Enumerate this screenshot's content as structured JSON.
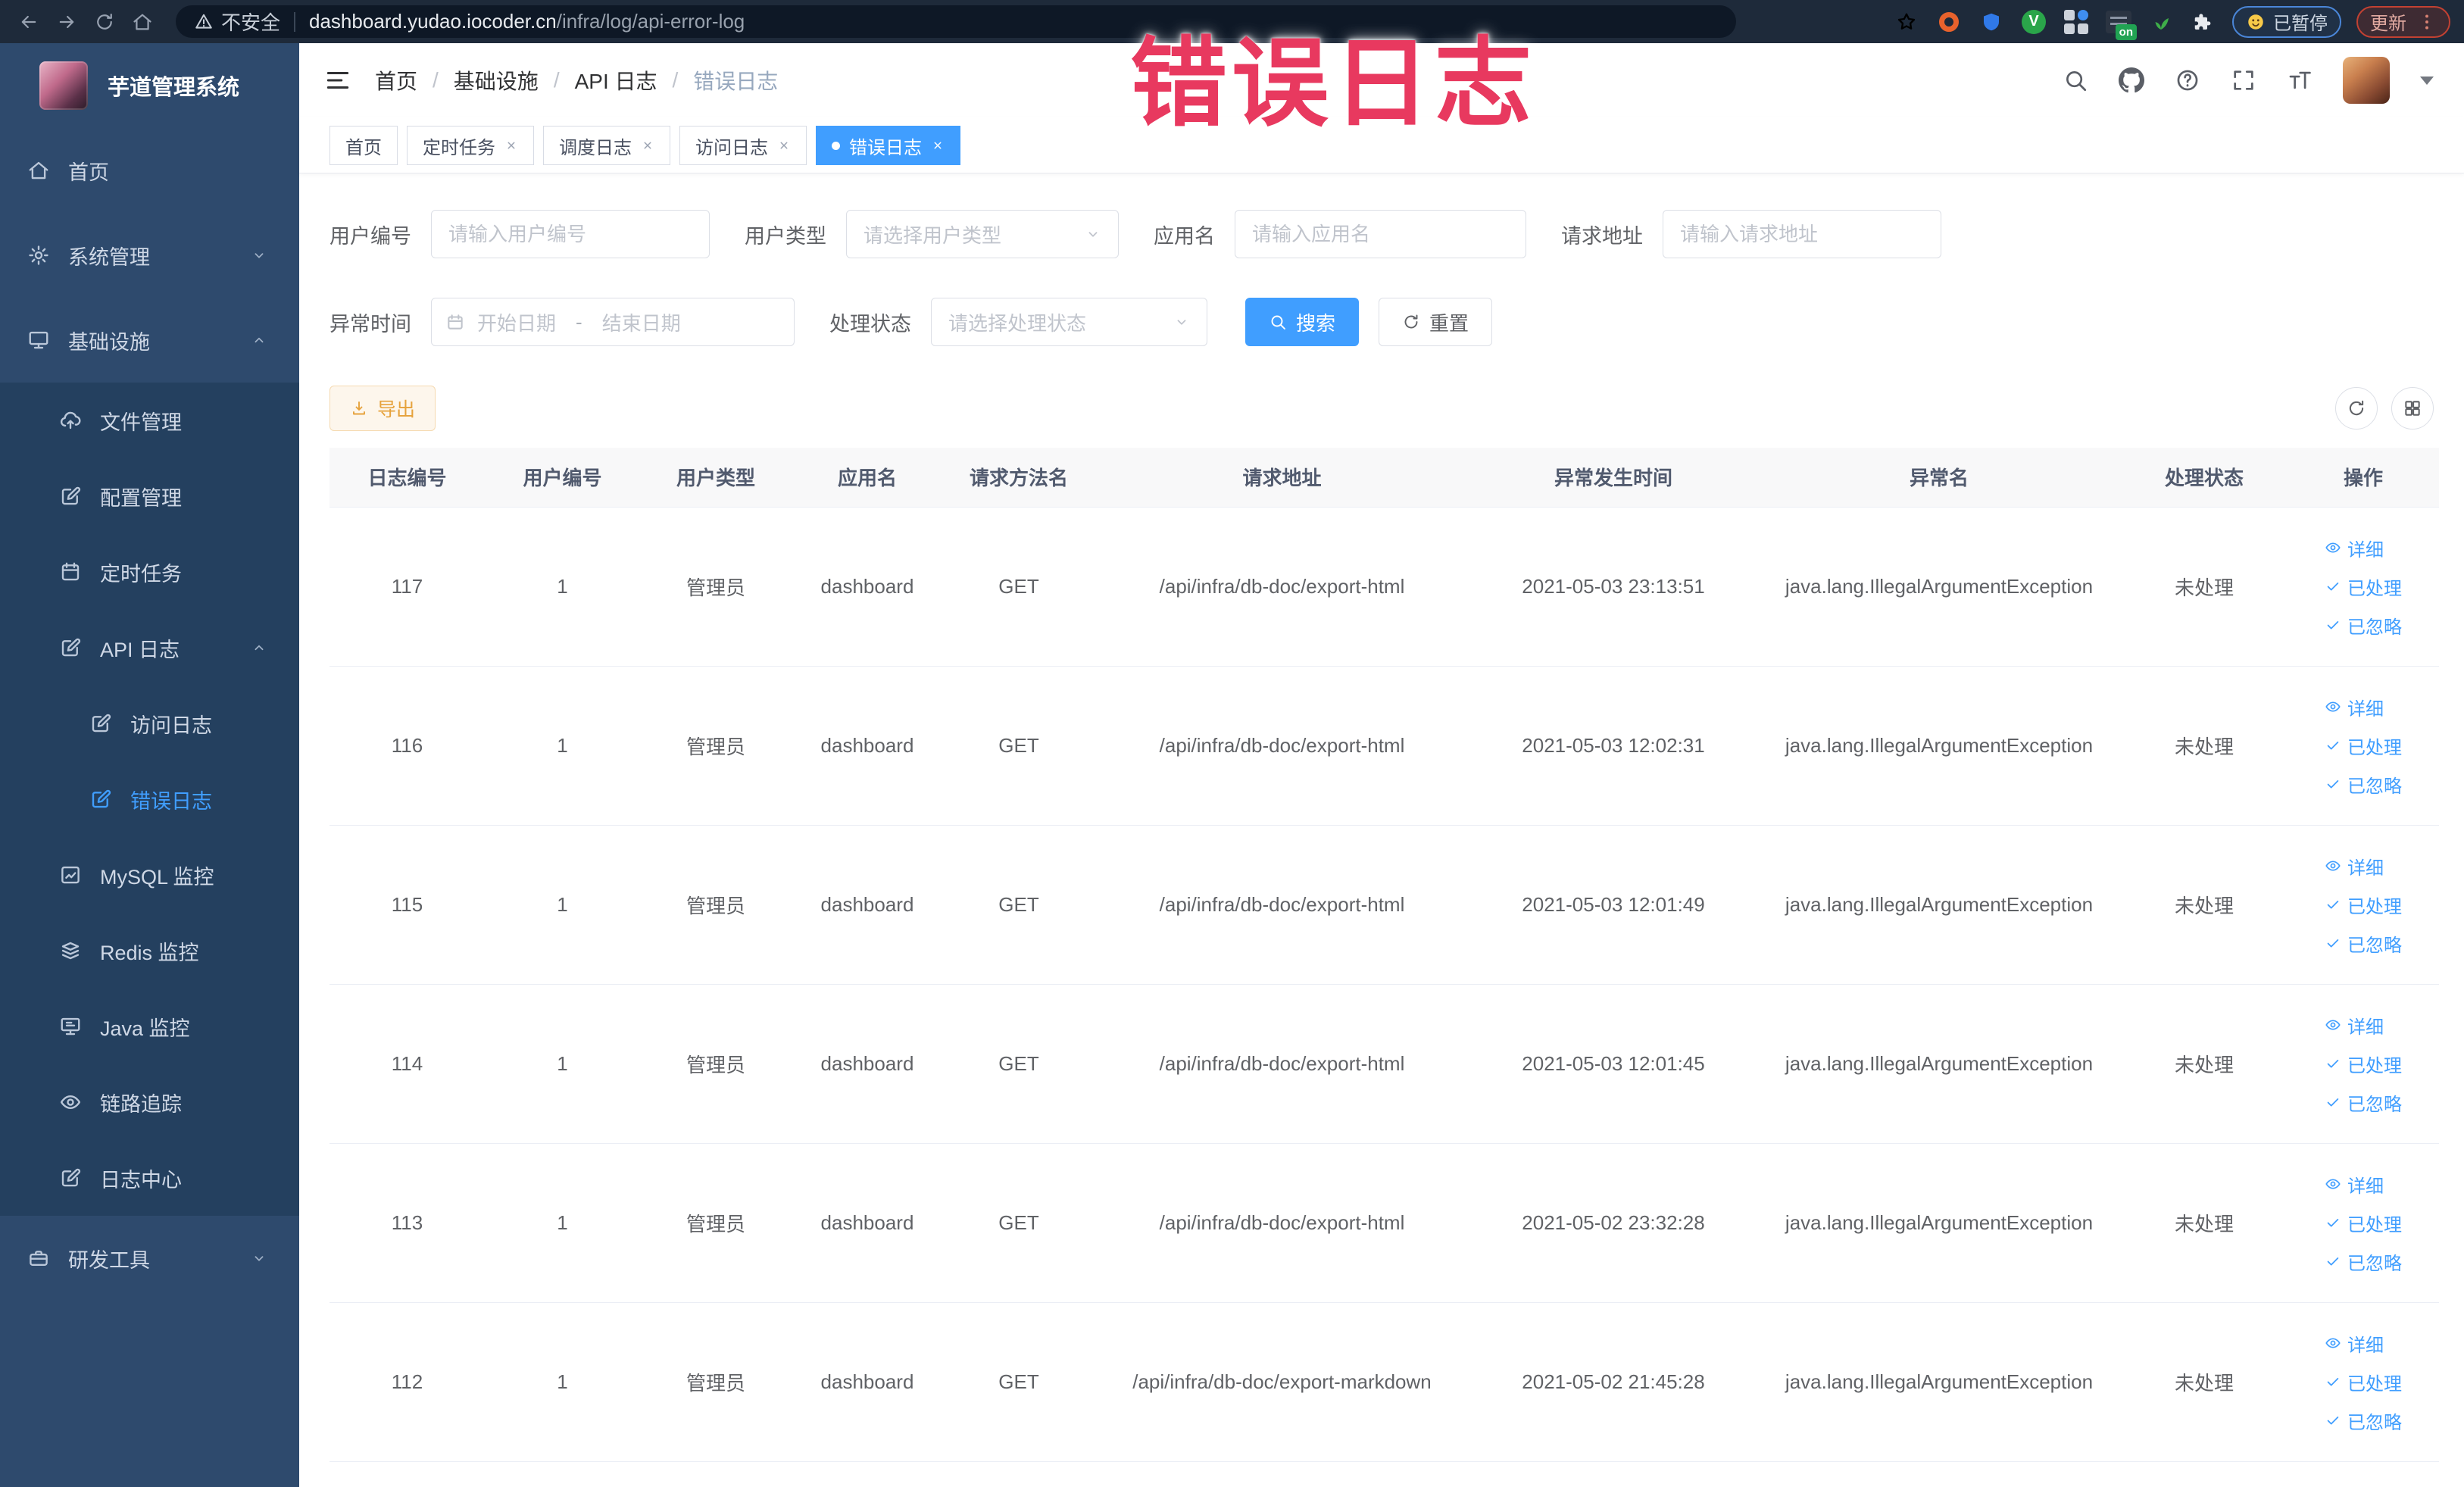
{
  "browser": {
    "security_text": "不安全",
    "url_host": "dashboard.yudao.iocoder.cn",
    "url_path": "/infra/log/api-error-log",
    "paused_label": "已暂停",
    "update_label": "更新",
    "ext_on_badge": "on"
  },
  "overlay_title": "错误日志",
  "sidebar": {
    "app_title": "芋道管理系统",
    "menu": [
      {
        "id": "home",
        "label": "首页",
        "icon": "home-icon",
        "level": 0
      },
      {
        "id": "system",
        "label": "系统管理",
        "icon": "gear-icon",
        "level": 0,
        "chevron": "down"
      },
      {
        "id": "infra",
        "label": "基础设施",
        "icon": "monitor-icon",
        "level": 0,
        "chevron": "up"
      },
      {
        "id": "file",
        "label": "文件管理",
        "icon": "upload-cloud-icon",
        "level": 1
      },
      {
        "id": "config",
        "label": "配置管理",
        "icon": "edit-square-icon",
        "level": 1
      },
      {
        "id": "job",
        "label": "定时任务",
        "icon": "calendar-icon",
        "level": 1
      },
      {
        "id": "api-log",
        "label": "API 日志",
        "icon": "edit-square-icon",
        "level": 1,
        "chevron": "up"
      },
      {
        "id": "access-log",
        "label": "访问日志",
        "icon": "edit-square-icon",
        "level": 2
      },
      {
        "id": "error-log",
        "label": "错误日志",
        "icon": "edit-square-icon",
        "level": 2,
        "active": true
      },
      {
        "id": "mysql",
        "label": "MySQL 监控",
        "icon": "chart-box-icon",
        "level": 1
      },
      {
        "id": "redis",
        "label": "Redis 监控",
        "icon": "layers-icon",
        "level": 1
      },
      {
        "id": "java",
        "label": "Java 监控",
        "icon": "monitor-lines-icon",
        "level": 1
      },
      {
        "id": "trace",
        "label": "链路追踪",
        "icon": "eye-icon",
        "level": 1
      },
      {
        "id": "log-center",
        "label": "日志中心",
        "icon": "edit-square-icon",
        "level": 1
      },
      {
        "id": "dev-tool",
        "label": "研发工具",
        "icon": "briefcase-icon",
        "level": 0,
        "chevron": "down"
      }
    ]
  },
  "navbar": {
    "breadcrumb": [
      "首页",
      "基础设施",
      "API 日志",
      "错误日志"
    ]
  },
  "tabs": [
    {
      "label": "首页",
      "closable": false,
      "active": false
    },
    {
      "label": "定时任务",
      "closable": true,
      "active": false
    },
    {
      "label": "调度日志",
      "closable": true,
      "active": false
    },
    {
      "label": "访问日志",
      "closable": true,
      "active": false
    },
    {
      "label": "错误日志",
      "closable": true,
      "active": true
    }
  ],
  "filters": {
    "user_id": {
      "label": "用户编号",
      "placeholder": "请输入用户编号"
    },
    "user_type": {
      "label": "用户类型",
      "placeholder": "请选择用户类型"
    },
    "app_name": {
      "label": "应用名",
      "placeholder": "请输入应用名"
    },
    "request_url": {
      "label": "请求地址",
      "placeholder": "请输入请求地址"
    },
    "exception_time": {
      "label": "异常时间",
      "start_placeholder": "开始日期",
      "separator": "-",
      "end_placeholder": "结束日期"
    },
    "process_status": {
      "label": "处理状态",
      "placeholder": "请选择处理状态"
    },
    "search_label": "搜索",
    "reset_label": "重置"
  },
  "toolbar": {
    "export_label": "导出"
  },
  "table": {
    "columns": [
      "日志编号",
      "用户编号",
      "用户类型",
      "应用名",
      "请求方法名",
      "请求地址",
      "异常发生时间",
      "异常名",
      "处理状态",
      "操作"
    ],
    "action_labels": [
      "详细",
      "已处理",
      "已忽略"
    ],
    "rows": [
      {
        "log_id": "117",
        "user_id": "1",
        "user_type": "管理员",
        "app_name": "dashboard",
        "method": "GET",
        "url": "/api/infra/db-doc/export-html",
        "time": "2021-05-03 23:13:51",
        "exception": "java.lang.IllegalArgumentException",
        "status": "未处理"
      },
      {
        "log_id": "116",
        "user_id": "1",
        "user_type": "管理员",
        "app_name": "dashboard",
        "method": "GET",
        "url": "/api/infra/db-doc/export-html",
        "time": "2021-05-03 12:02:31",
        "exception": "java.lang.IllegalArgumentException",
        "status": "未处理"
      },
      {
        "log_id": "115",
        "user_id": "1",
        "user_type": "管理员",
        "app_name": "dashboard",
        "method": "GET",
        "url": "/api/infra/db-doc/export-html",
        "time": "2021-05-03 12:01:49",
        "exception": "java.lang.IllegalArgumentException",
        "status": "未处理"
      },
      {
        "log_id": "114",
        "user_id": "1",
        "user_type": "管理员",
        "app_name": "dashboard",
        "method": "GET",
        "url": "/api/infra/db-doc/export-html",
        "time": "2021-05-03 12:01:45",
        "exception": "java.lang.IllegalArgumentException",
        "status": "未处理"
      },
      {
        "log_id": "113",
        "user_id": "1",
        "user_type": "管理员",
        "app_name": "dashboard",
        "method": "GET",
        "url": "/api/infra/db-doc/export-html",
        "time": "2021-05-02 23:32:28",
        "exception": "java.lang.IllegalArgumentException",
        "status": "未处理"
      },
      {
        "log_id": "112",
        "user_id": "1",
        "user_type": "管理员",
        "app_name": "dashboard",
        "method": "GET",
        "url": "/api/infra/db-doc/export-markdown",
        "time": "2021-05-02 21:45:28",
        "exception": "java.lang.IllegalArgumentException",
        "status": "未处理"
      }
    ]
  },
  "colors": {
    "primary": "#409eff",
    "warning": "#e6a23c",
    "sidebar_bg": "#2e4a6d",
    "sidebar_sub_bg": "#24405f",
    "browser_bar_bg": "#1e2a3a",
    "overlay_pink": "#e8395f"
  }
}
